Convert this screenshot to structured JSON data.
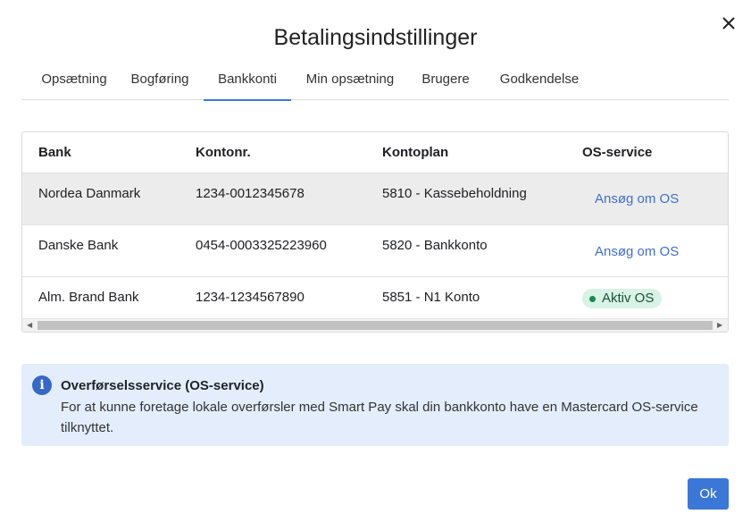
{
  "dialog": {
    "title": "Betalingsindstillinger"
  },
  "tabs": [
    {
      "label": "Opsætning"
    },
    {
      "label": "Bogføring"
    },
    {
      "label": "Bankkonti",
      "active": true
    },
    {
      "label": "Min opsætning"
    },
    {
      "label": "Brugere"
    },
    {
      "label": "Godkendelse"
    }
  ],
  "table": {
    "columns": [
      "Bank",
      "Kontonr.",
      "Kontoplan",
      "OS-service"
    ],
    "rows": [
      {
        "bank": "Nordea Danmark",
        "account": "1234-0012345678",
        "plan": "5810 - Kassebeholdning",
        "os": "Ansøg om OS",
        "os_type": "link",
        "selected": true
      },
      {
        "bank": "Danske Bank",
        "account": "0454-0003325223960",
        "plan": "5820 - Bankkonto",
        "os": "Ansøg om OS",
        "os_type": "link"
      },
      {
        "bank": "Alm. Brand Bank",
        "account": "1234-1234567890",
        "plan": "5851 - N1 Konto",
        "os": "Aktiv OS",
        "os_type": "badge"
      }
    ]
  },
  "info": {
    "icon": "info-icon",
    "heading": "Overførselsservice (OS-service)",
    "text": "For at kunne foretage lokale overførsler med Smart Pay skal din bankkonto have en Mastercard OS-service tilknyttet."
  },
  "footer": {
    "ok_label": "Ok"
  },
  "colors": {
    "accent": "#3b77d6",
    "link": "#3f6fc8",
    "success": "#178a55",
    "info_bg": "#e3edfc"
  }
}
